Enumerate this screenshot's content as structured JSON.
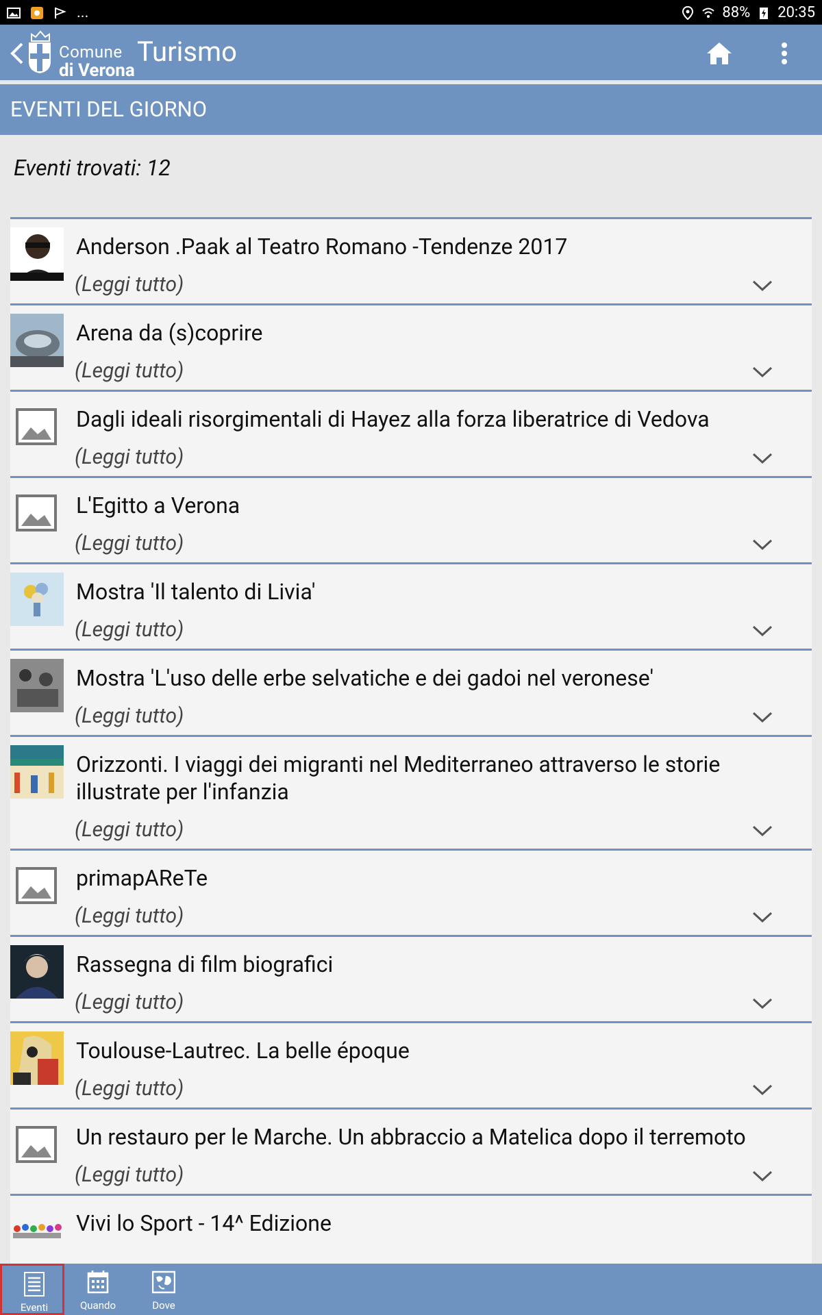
{
  "statusbar": {
    "battery": "88%",
    "time": "20:35",
    "notifications_more": "..."
  },
  "header": {
    "logo_line1": "Comune",
    "logo_line2": "di Verona",
    "title": "Turismo"
  },
  "section_title": "EVENTI DEL GIORNO",
  "events_found": "Eventi trovati: 12",
  "read_more_label": "(Leggi tutto)",
  "events": [
    {
      "title": "Anderson .Paak al Teatro Romano -Tendenze 2017",
      "thumb": "photo-person"
    },
    {
      "title": "Arena da (s)coprire",
      "thumb": "photo-arena"
    },
    {
      "title": "Dagli ideali risorgimentali di Hayez alla forza liberatrice di Vedova",
      "thumb": "placeholder-image"
    },
    {
      "title": "L'Egitto a Verona",
      "thumb": "placeholder-image"
    },
    {
      "title": "Mostra 'Il talento di Livia'",
      "thumb": "photo-flowers"
    },
    {
      "title": "Mostra 'L'uso delle erbe selvatiche e dei gadoi nel veronese'",
      "thumb": "photo-bw"
    },
    {
      "title": "Orizzonti. I viaggi dei migranti nel Mediterraneo attraverso le storie illustrate per l'infanzia",
      "thumb": "photo-poster"
    },
    {
      "title": "primapAReTe",
      "thumb": "placeholder-image"
    },
    {
      "title": "Rassegna di film biografici",
      "thumb": "photo-portrait"
    },
    {
      "title": "Toulouse-Lautrec. La belle époque",
      "thumb": "photo-poster-yellow"
    },
    {
      "title": "Un restauro per le Marche. Un abbraccio a Matelica dopo il terremoto",
      "thumb": "placeholder-image"
    },
    {
      "title": "Vivi lo Sport - 14^ Edizione",
      "thumb": "photo-sport"
    }
  ],
  "bottom_tabs": [
    {
      "label": "Eventi",
      "icon": "list-icon"
    },
    {
      "label": "Quando",
      "icon": "calendar-icon"
    },
    {
      "label": "Dove",
      "icon": "map-icon"
    }
  ],
  "colors": {
    "primary": "#6f93c0",
    "active_tab_border": "#d23434"
  }
}
